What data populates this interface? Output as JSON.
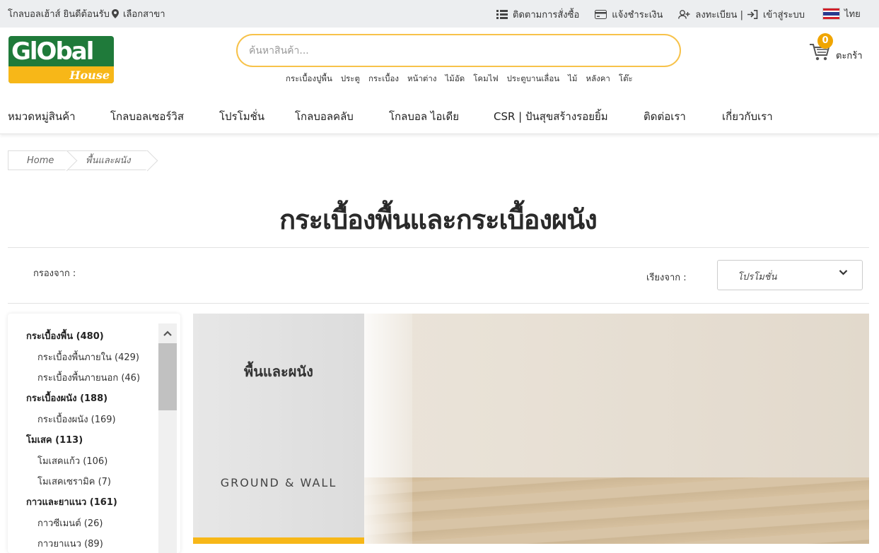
{
  "topbar": {
    "greeting": "โกลบอลเฮ้าส์ ยินดีต้อนรับ",
    "branch": "เลือกสาขา",
    "track_order": "ติดตามการสั่งซื้อ",
    "payment_notice": "แจ้งชำระเงิน",
    "register": "ลงทะเบียน |",
    "login": "เข้าสู่ระบบ",
    "language": "ไทย"
  },
  "logo": {
    "word": "GlObal",
    "sub": "House"
  },
  "search": {
    "placeholder": "ค้นหาสินค้า..."
  },
  "quick_links": [
    "กระเบื้องปูพื้น",
    "ประตู",
    "กระเบื้อง",
    "หน้าต่าง",
    "ไม้อัด",
    "โคมไฟ",
    "ประตูบานเลื่อน",
    "ไม้",
    "หลังคา",
    "โต๊ะ"
  ],
  "cart": {
    "count": "0",
    "label": "ตะกร้า"
  },
  "nav": [
    "หมวดหมู่สินค้า",
    "โกลบอลเซอร์วิส",
    "โปรโมชั่น",
    "โกลบอลคลับ",
    "โกลบอล ไอเดีย",
    "CSR | ปันสุขสร้างรอยยิ้ม",
    "ติดต่อเรา",
    "เกี่ยวกับเรา"
  ],
  "breadcrumb": {
    "home": "Home",
    "current": "พื้นและผนัง"
  },
  "page_title": "กระเบื้องพื้นและกระเบื้องผนัง",
  "filter_label": "กรองจาก :",
  "sort": {
    "label": "เรียงจาก :",
    "selected": "โปรโมชั่น"
  },
  "categories": [
    {
      "label": "กระเบื้องพื้น (480)",
      "level": "parent"
    },
    {
      "label": "กระเบื้องพื้นภายใน (429)",
      "level": "child"
    },
    {
      "label": "กระเบื้องพื้นภายนอก (46)",
      "level": "child"
    },
    {
      "label": "กระเบื้องผนัง (188)",
      "level": "parent"
    },
    {
      "label": "กระเบื้องผนัง (169)",
      "level": "child"
    },
    {
      "label": "โมเสค (113)",
      "level": "parent"
    },
    {
      "label": "โมเสคแก้ว (106)",
      "level": "child"
    },
    {
      "label": "โมเสคเซรามิค (7)",
      "level": "child"
    },
    {
      "label": "กาวและยาแนว (161)",
      "level": "parent"
    },
    {
      "label": "กาวซีเมนต์ (26)",
      "level": "child"
    },
    {
      "label": "กาวยาแนว (89)",
      "level": "child"
    }
  ],
  "banner": {
    "title_th": "พื้นและผนัง",
    "title_en": "GROUND & WALL"
  },
  "colors": {
    "accent": "#f7b718",
    "brand_green": "#1f7a3a",
    "cart_badge": "#f0a500"
  },
  "icons": [
    "location-pin-icon",
    "list-icon",
    "credit-card-icon",
    "user-plus-icon",
    "sign-in-icon",
    "thai-flag-icon",
    "cart-icon",
    "chevron-down-icon",
    "chevron-up-icon"
  ]
}
